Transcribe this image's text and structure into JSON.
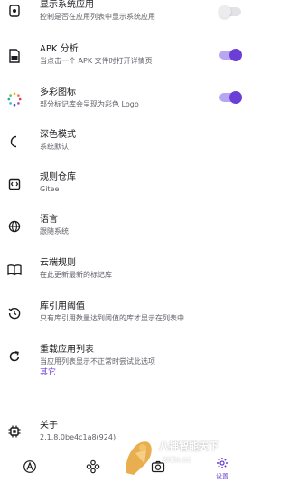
{
  "settings": {
    "items": [
      {
        "title": "显示系统应用",
        "subtitle": "控制是否在应用列表中显示系统应用",
        "icon": "system-apps-icon",
        "toggle": false
      },
      {
        "title": "APK 分析",
        "subtitle": "当点击一个 APK 文件时打开详情页",
        "icon": "apk-file-icon",
        "toggle": true
      },
      {
        "title": "多彩图标",
        "subtitle": "部分标记库会呈现为彩色 Logo",
        "icon": "colorful-icons-icon",
        "toggle": true
      },
      {
        "title": "深色模式",
        "subtitle": "系统默认",
        "icon": "dark-mode-icon"
      },
      {
        "title": "规则仓库",
        "subtitle": "Gitee",
        "icon": "repository-icon"
      },
      {
        "title": "语言",
        "subtitle": "跟随系统",
        "icon": "language-globe-icon"
      },
      {
        "title": "云端规则",
        "subtitle": "在此更新最新的标记库",
        "icon": "cloud-rules-book-icon"
      },
      {
        "title": "库引用阈值",
        "subtitle": "只有库引用数量达到阈值的库才显示在列表中",
        "icon": "threshold-icon"
      },
      {
        "title": "重载应用列表",
        "subtitle": "当应用列表显示不正常时尝试此选项",
        "icon": "reload-icon"
      }
    ],
    "section_other": "其它",
    "about": {
      "title": "关于",
      "subtitle": "2.1.8.0be4c1a8(924)",
      "icon": "chip-icon"
    }
  },
  "bottom_nav": {
    "items": [
      {
        "icon": "apps-icon",
        "label": ""
      },
      {
        "icon": "snapshot-icon",
        "label": ""
      },
      {
        "icon": "camera-icon",
        "label": ""
      },
      {
        "icon": "settings-gear-icon",
        "label": "设置"
      }
    ]
  },
  "watermark": {
    "text_cn": "八神智能天下",
    "text_en": "zntx.cc"
  },
  "colors": {
    "accent": "#6b3fd6",
    "switch_on_track": "#b9a6f2",
    "switch_off_track": "#e3e3e6",
    "text_primary": "#1b1b1f",
    "text_secondary": "#5f5f67"
  }
}
